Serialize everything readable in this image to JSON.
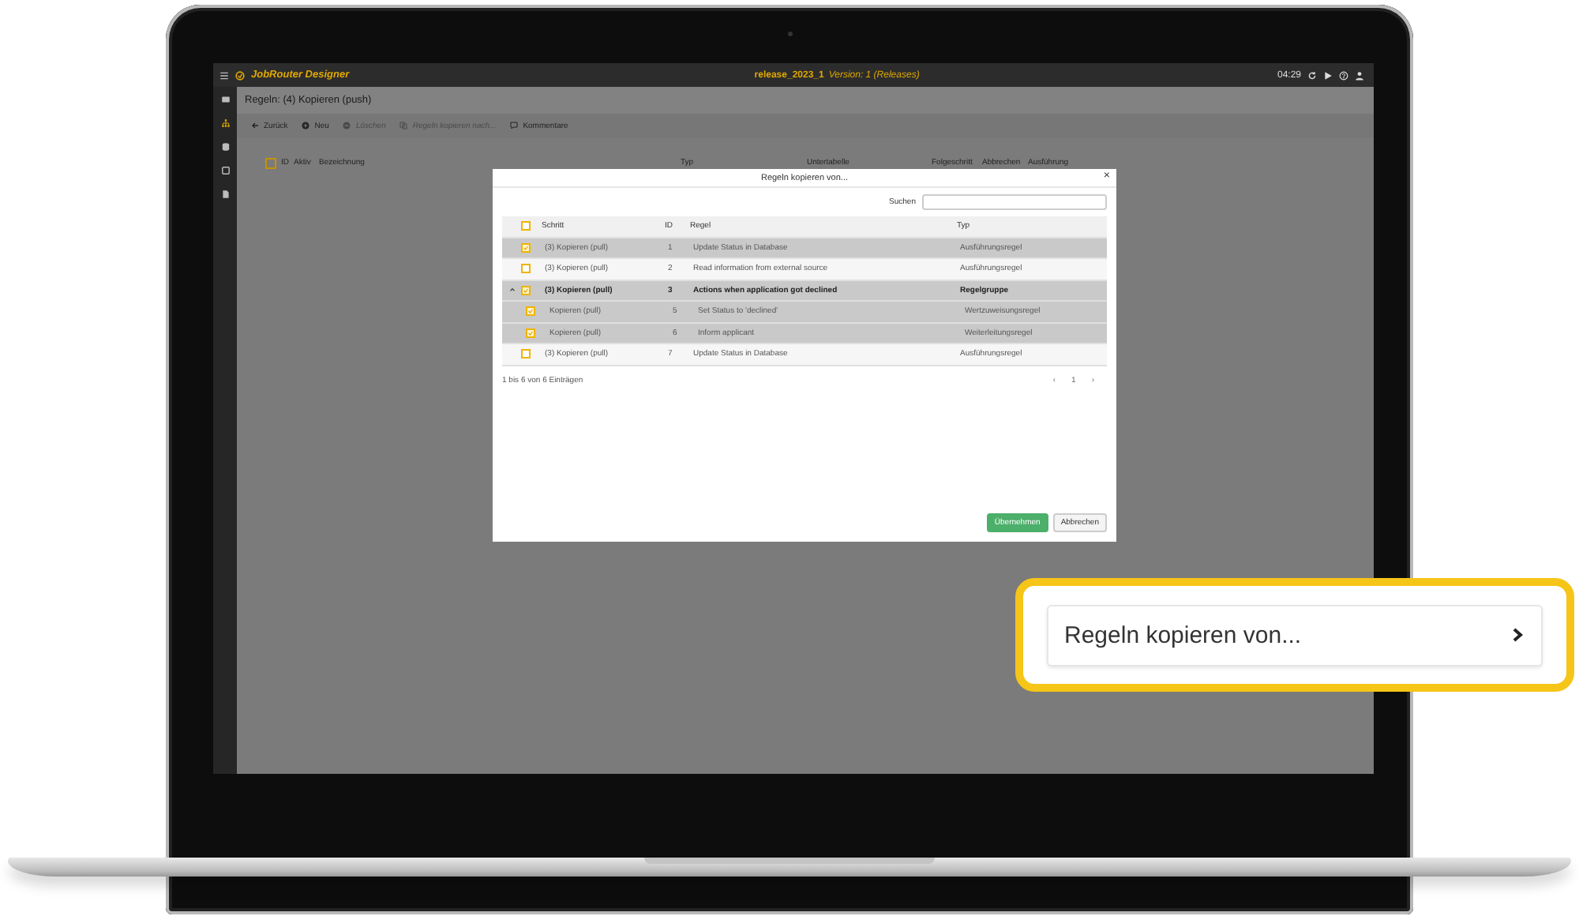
{
  "app": {
    "logo": "JobRouter Designer",
    "release": "release_2023_1",
    "version": "Version: 1 (Releases)",
    "time": "04:29"
  },
  "sidebar": {
    "items": [
      {
        "kind": "card",
        "selected": false
      },
      {
        "kind": "sitemap",
        "selected": true
      },
      {
        "kind": "database",
        "selected": false
      },
      {
        "kind": "box",
        "selected": false
      },
      {
        "kind": "document",
        "selected": false
      }
    ]
  },
  "page": {
    "title": "Regeln: (4) Kopieren (push)"
  },
  "toolbar": [
    {
      "kind": "back",
      "label": "Zurück",
      "disabled": false
    },
    {
      "kind": "add",
      "label": "Neu",
      "disabled": false
    },
    {
      "kind": "delete",
      "label": "Löschen",
      "disabled": true
    },
    {
      "kind": "copy",
      "label": "Regeln kopieren nach...",
      "disabled": true
    },
    {
      "kind": "comment",
      "label": "Kommentare",
      "disabled": false
    }
  ],
  "table": {
    "select_all": {
      "checked": false
    },
    "columns": [
      "ID",
      "Aktiv",
      "Bezeichnung",
      "Typ",
      "Untertabelle",
      "Folgeschritt",
      "Abbrechen",
      "Ausführung"
    ]
  },
  "dialog": {
    "title": "Regeln kopieren von...",
    "close": "×",
    "search": {
      "label": "Suchen"
    },
    "select_all": {
      "checked": false
    },
    "columns": [
      "Schritt",
      "ID",
      "Regel",
      "Typ"
    ],
    "rows": [
      {
        "kind": "rule",
        "selected": true,
        "checked": true,
        "step": "(3) Kopieren (pull)",
        "id": "1",
        "rule": "Update Status in Database",
        "type": "Ausführungsregel"
      },
      {
        "kind": "rule",
        "selected": false,
        "checked": false,
        "step": "(3) Kopieren (pull)",
        "id": "2",
        "rule": "Read information from external source",
        "type": "Ausführungsregel"
      },
      {
        "kind": "group",
        "selected": true,
        "checked": true,
        "expanded": true,
        "step": "(3) Kopieren (pull)",
        "id": "3",
        "rule": "Actions when application got declined",
        "type": "Regelgruppe",
        "children": [
          {
            "selected": true,
            "checked": true,
            "step": "Kopieren (pull)",
            "id": "5",
            "rule": "Set Status to 'declined'",
            "type": "Wertzuweisungsregel"
          },
          {
            "selected": true,
            "checked": true,
            "step": "Kopieren (pull)",
            "id": "6",
            "rule": "Inform applicant",
            "type": "Weiterleitungsregel"
          }
        ]
      },
      {
        "kind": "rule",
        "selected": false,
        "checked": false,
        "step": "(3) Kopieren (pull)",
        "id": "7",
        "rule": "Update Status in Database",
        "type": "Ausführungsregel"
      }
    ],
    "info": "1 bis 6 von 6 Einträgen",
    "pagination": {
      "prev": "‹",
      "page": "1",
      "next": "›"
    },
    "buttons": [
      {
        "kind": "primary",
        "label": "Übernehmen"
      },
      {
        "kind": "secondary",
        "label": "Abbrechen"
      }
    ]
  },
  "callout": {
    "label": "Regeln kopieren von..."
  }
}
